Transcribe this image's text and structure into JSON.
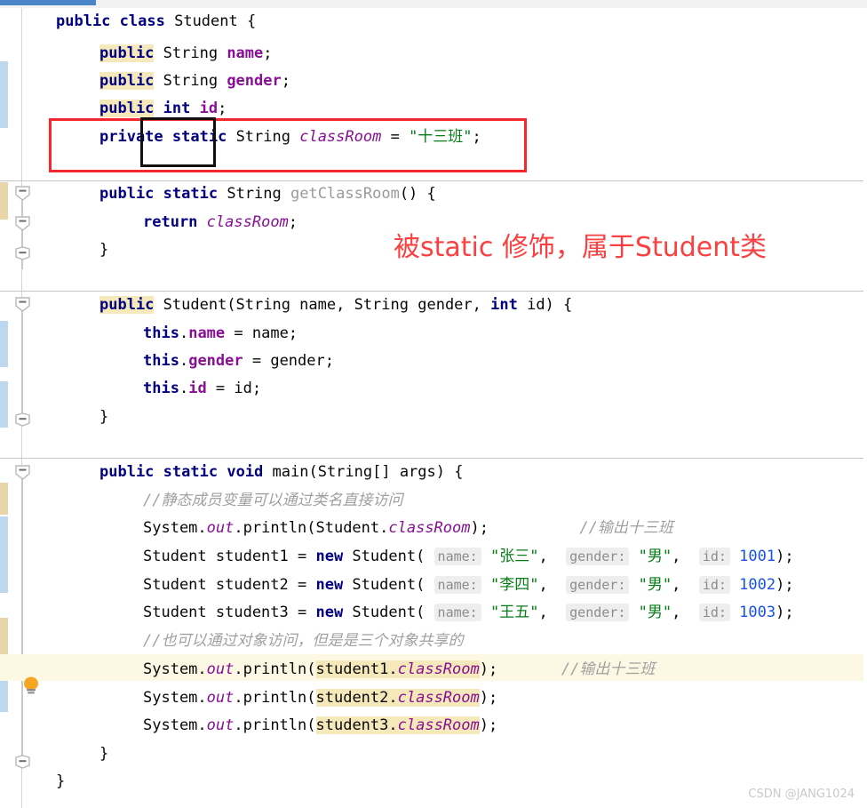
{
  "window": {
    "tab_label": "",
    "accent_color": "#4a86c8"
  },
  "watermark": {
    "text": "CSDN @JANG1024"
  },
  "annotation": {
    "text": "被static 修饰，属于Student类",
    "color": "#fa4040"
  },
  "highlight_boxes": {
    "red_box_target": "private static String classRoom = \"十三班\";",
    "black_box_target": "static"
  },
  "gutter": {
    "bulb_tooltip": "Show Context Actions",
    "fold_markers": [
      "collapse",
      "collapse",
      "expand",
      "collapse",
      "expand",
      "collapse",
      "expand"
    ]
  },
  "editor": {
    "language": "Java",
    "file_class": "Student",
    "lines": [
      {
        "indent": 0,
        "tokens": [
          {
            "t": "public",
            "c": "kw"
          },
          {
            "t": " ",
            "c": "plain"
          },
          {
            "t": "class",
            "c": "kw"
          },
          {
            "t": " Student {",
            "c": "plain"
          }
        ]
      },
      {
        "indent": 1,
        "tokens": [
          {
            "t": "public",
            "c": "kw hl"
          },
          {
            "t": " String ",
            "c": "plain"
          },
          {
            "t": "name",
            "c": "fld"
          },
          {
            "t": ";",
            "c": "plain"
          }
        ]
      },
      {
        "indent": 1,
        "tokens": [
          {
            "t": "public",
            "c": "kw hl"
          },
          {
            "t": " String ",
            "c": "plain"
          },
          {
            "t": "gender",
            "c": "fld"
          },
          {
            "t": ";",
            "c": "plain"
          }
        ]
      },
      {
        "indent": 1,
        "tokens": [
          {
            "t": "public",
            "c": "kw hl"
          },
          {
            "t": " ",
            "c": "plain"
          },
          {
            "t": "int",
            "c": "kw"
          },
          {
            "t": " ",
            "c": "plain"
          },
          {
            "t": "id",
            "c": "fld"
          },
          {
            "t": ";",
            "c": "plain"
          }
        ]
      },
      {
        "indent": 1,
        "tokens": [
          {
            "t": "private",
            "c": "kw"
          },
          {
            "t": " ",
            "c": "plain"
          },
          {
            "t": "static",
            "c": "kw"
          },
          {
            "t": " String ",
            "c": "plain"
          },
          {
            "t": "classRoom",
            "c": "stat"
          },
          {
            "t": " = ",
            "c": "plain"
          },
          {
            "t": "\"十三班\"",
            "c": "str"
          },
          {
            "t": ";",
            "c": "plain"
          }
        ]
      },
      {
        "indent": 1,
        "tokens": [
          {
            "t": "public",
            "c": "kw"
          },
          {
            "t": " ",
            "c": "plain"
          },
          {
            "t": "static",
            "c": "kw"
          },
          {
            "t": " String ",
            "c": "plain"
          },
          {
            "t": "getClassRoom",
            "c": "mth"
          },
          {
            "t": "() {",
            "c": "plain"
          }
        ]
      },
      {
        "indent": 2,
        "tokens": [
          {
            "t": "return",
            "c": "kw"
          },
          {
            "t": " ",
            "c": "plain"
          },
          {
            "t": "classRoom",
            "c": "stat"
          },
          {
            "t": ";",
            "c": "plain"
          }
        ]
      },
      {
        "indent": 1,
        "tokens": [
          {
            "t": "}",
            "c": "plain"
          }
        ]
      },
      {
        "indent": 1,
        "tokens": [
          {
            "t": "public",
            "c": "kw hl"
          },
          {
            "t": " Student(String name, String gender, ",
            "c": "plain"
          },
          {
            "t": "int",
            "c": "kw"
          },
          {
            "t": " id) {",
            "c": "plain"
          }
        ]
      },
      {
        "indent": 2,
        "tokens": [
          {
            "t": "this",
            "c": "kw"
          },
          {
            "t": ".",
            "c": "plain"
          },
          {
            "t": "name",
            "c": "fld"
          },
          {
            "t": " = name;",
            "c": "plain"
          }
        ]
      },
      {
        "indent": 2,
        "tokens": [
          {
            "t": "this",
            "c": "kw"
          },
          {
            "t": ".",
            "c": "plain"
          },
          {
            "t": "gender",
            "c": "fld"
          },
          {
            "t": " = gender;",
            "c": "plain"
          }
        ]
      },
      {
        "indent": 2,
        "tokens": [
          {
            "t": "this",
            "c": "kw"
          },
          {
            "t": ".",
            "c": "plain"
          },
          {
            "t": "id",
            "c": "fld"
          },
          {
            "t": " = id;",
            "c": "plain"
          }
        ]
      },
      {
        "indent": 1,
        "tokens": [
          {
            "t": "}",
            "c": "plain"
          }
        ]
      },
      {
        "indent": 1,
        "tokens": [
          {
            "t": "public",
            "c": "kw"
          },
          {
            "t": " ",
            "c": "plain"
          },
          {
            "t": "static",
            "c": "kw"
          },
          {
            "t": " ",
            "c": "plain"
          },
          {
            "t": "void",
            "c": "kw"
          },
          {
            "t": " main(String[] args) {",
            "c": "plain"
          }
        ]
      },
      {
        "indent": 2,
        "tokens": [
          {
            "t": "//静态成员变量可以通过类名直接访问",
            "c": "cmt"
          }
        ]
      },
      {
        "indent": 2,
        "tokens": [
          {
            "t": "System.",
            "c": "plain"
          },
          {
            "t": "out",
            "c": "stat"
          },
          {
            "t": ".println(Student.",
            "c": "plain"
          },
          {
            "t": "classRoom",
            "c": "stat"
          },
          {
            "t": ");",
            "c": "plain"
          },
          {
            "t": "          ",
            "c": "plain"
          },
          {
            "t": "//输出十三班",
            "c": "cmt"
          }
        ]
      },
      {
        "indent": 2,
        "tokens": [
          {
            "t": "Student student1 = ",
            "c": "plain"
          },
          {
            "t": "new",
            "c": "kw"
          },
          {
            "t": " Student( ",
            "c": "plain"
          },
          {
            "t": "name:",
            "c": "hint"
          },
          {
            "t": " ",
            "c": "plain"
          },
          {
            "t": "\"张三\"",
            "c": "str"
          },
          {
            "t": ",  ",
            "c": "plain"
          },
          {
            "t": "gender:",
            "c": "hint"
          },
          {
            "t": " ",
            "c": "plain"
          },
          {
            "t": "\"男\"",
            "c": "str"
          },
          {
            "t": ",  ",
            "c": "plain"
          },
          {
            "t": "id:",
            "c": "hint"
          },
          {
            "t": " ",
            "c": "plain"
          },
          {
            "t": "1001",
            "c": "num"
          },
          {
            "t": ");",
            "c": "plain"
          }
        ]
      },
      {
        "indent": 2,
        "tokens": [
          {
            "t": "Student student2 = ",
            "c": "plain"
          },
          {
            "t": "new",
            "c": "kw"
          },
          {
            "t": " Student( ",
            "c": "plain"
          },
          {
            "t": "name:",
            "c": "hint"
          },
          {
            "t": " ",
            "c": "plain"
          },
          {
            "t": "\"李四\"",
            "c": "str"
          },
          {
            "t": ",  ",
            "c": "plain"
          },
          {
            "t": "gender:",
            "c": "hint"
          },
          {
            "t": " ",
            "c": "plain"
          },
          {
            "t": "\"男\"",
            "c": "str"
          },
          {
            "t": ",  ",
            "c": "plain"
          },
          {
            "t": "id:",
            "c": "hint"
          },
          {
            "t": " ",
            "c": "plain"
          },
          {
            "t": "1002",
            "c": "num"
          },
          {
            "t": ");",
            "c": "plain"
          }
        ]
      },
      {
        "indent": 2,
        "tokens": [
          {
            "t": "Student student3 = ",
            "c": "plain"
          },
          {
            "t": "new",
            "c": "kw"
          },
          {
            "t": " Student( ",
            "c": "plain"
          },
          {
            "t": "name:",
            "c": "hint"
          },
          {
            "t": " ",
            "c": "plain"
          },
          {
            "t": "\"王五\"",
            "c": "str"
          },
          {
            "t": ",  ",
            "c": "plain"
          },
          {
            "t": "gender:",
            "c": "hint"
          },
          {
            "t": " ",
            "c": "plain"
          },
          {
            "t": "\"男\"",
            "c": "str"
          },
          {
            "t": ",  ",
            "c": "plain"
          },
          {
            "t": "id:",
            "c": "hint"
          },
          {
            "t": " ",
            "c": "plain"
          },
          {
            "t": "1003",
            "c": "num"
          },
          {
            "t": ");",
            "c": "plain"
          }
        ]
      },
      {
        "indent": 2,
        "tokens": [
          {
            "t": "//也可以通过对象访问，但是是三个对象共享的",
            "c": "cmt"
          }
        ]
      },
      {
        "indent": 2,
        "tokens": [
          {
            "t": "System.",
            "c": "plain"
          },
          {
            "t": "out",
            "c": "stat"
          },
          {
            "t": ".println(",
            "c": "plain"
          },
          {
            "t": "student1.",
            "c": "plain hl"
          },
          {
            "t": "classRoom",
            "c": "stat hl"
          },
          {
            "t": ");",
            "c": "plain"
          },
          {
            "t": "       ",
            "c": "plain"
          },
          {
            "t": "//输出十三班",
            "c": "cmt"
          }
        ]
      },
      {
        "indent": 2,
        "tokens": [
          {
            "t": "System.",
            "c": "plain"
          },
          {
            "t": "out",
            "c": "stat"
          },
          {
            "t": ".println(",
            "c": "plain"
          },
          {
            "t": "student2.",
            "c": "plain hl"
          },
          {
            "t": "classRoom",
            "c": "stat hl"
          },
          {
            "t": ");",
            "c": "plain"
          }
        ]
      },
      {
        "indent": 2,
        "tokens": [
          {
            "t": "System.",
            "c": "plain"
          },
          {
            "t": "out",
            "c": "stat"
          },
          {
            "t": ".println(",
            "c": "plain"
          },
          {
            "t": "student3.",
            "c": "plain hl"
          },
          {
            "t": "classRoom",
            "c": "stat hl"
          },
          {
            "t": ");",
            "c": "plain"
          }
        ]
      },
      {
        "indent": 1,
        "tokens": [
          {
            "t": "}",
            "c": "plain"
          }
        ]
      },
      {
        "indent": 0,
        "tokens": [
          {
            "t": "}",
            "c": "plain"
          }
        ]
      }
    ]
  }
}
